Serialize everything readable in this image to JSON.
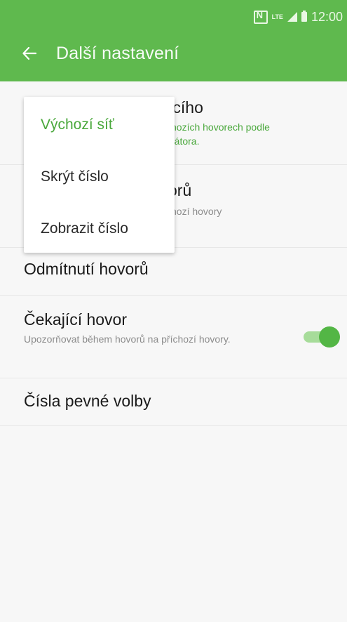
{
  "status_bar": {
    "time": "12:00",
    "icons": [
      "nfc-icon",
      "lte-icon",
      "signal-icon",
      "battery-icon"
    ],
    "lte_label": "LTE"
  },
  "app_bar": {
    "title": "Další nastavení",
    "back_icon": "back-arrow-icon",
    "color": "#5fb94e"
  },
  "settings": {
    "caller_id": {
      "title_visible": "ícího",
      "subtitle_line1": "hozích hovorech podle",
      "subtitle_line2": "rátora."
    },
    "call_forwarding": {
      "title_visible": "orů",
      "subtitle": "hozí hovory"
    },
    "call_rejection": {
      "title": "Odmítnutí hovorů"
    },
    "call_waiting": {
      "title": "Čekající hovor",
      "subtitle": "Upozorňovat během hovorů na příchozí hovory.",
      "toggle_on": true
    },
    "fixed_dialing": {
      "title": "Čísla pevné volby"
    }
  },
  "popup_menu": {
    "items": [
      {
        "label": "Výchozí síť",
        "selected": true
      },
      {
        "label": "Skrýt číslo",
        "selected": false
      },
      {
        "label": "Zobrazit číslo",
        "selected": false
      }
    ]
  },
  "colors": {
    "accent": "#4aa83c",
    "toggle_thumb": "#53b645",
    "toggle_track": "#a7dc9a"
  }
}
